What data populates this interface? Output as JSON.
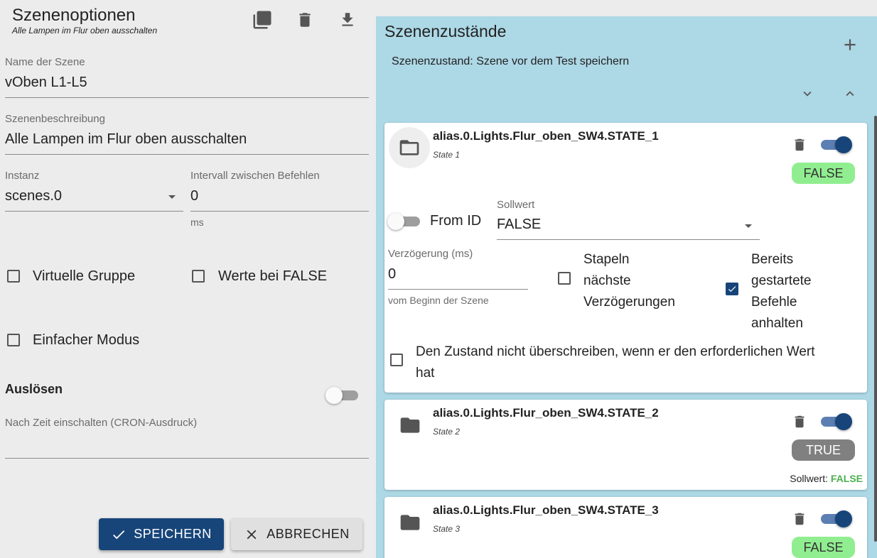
{
  "left": {
    "title": "Szenenoptionen",
    "subtitle": "Alle Lampen im Flur oben ausschalten",
    "name_label": "Name der Szene",
    "name_value": "vOben L1-L5",
    "desc_label": "Szenenbeschreibung",
    "desc_value": "Alle Lampen im Flur oben ausschalten",
    "instance_label": "Instanz",
    "instance_value": "scenes.0",
    "interval_label": "Intervall zwischen Befehlen",
    "interval_value": "0",
    "interval_unit": "ms",
    "virtual_group_label": "Virtuelle Gruppe",
    "values_false_label": "Werte bei FALSE",
    "simple_mode_label": "Einfacher Modus",
    "trigger_heading": "Auslösen",
    "cron_label": "Nach Zeit einschalten (CRON-Ausdruck)",
    "save_label": "SPEICHERN",
    "cancel_label": "ABBRECHEN"
  },
  "right": {
    "title": "Szenenzustände",
    "state_info": "Szenenzustand: Szene vor dem Test speichern",
    "cards": [
      {
        "id": "alias.0.Lights.Flur_oben_SW4.STATE_1",
        "sub": "State 1",
        "badge": "FALSE",
        "from_id_label": "From ID",
        "setpoint_label": "Sollwert",
        "setpoint_value": "FALSE",
        "delay_label": "Verzögerung (ms)",
        "delay_value": "0",
        "delay_helper": "vom Beginn der Szene",
        "stack_label_1": "Stapeln",
        "stack_label_2": "nächste",
        "stack_label_3": "Verzögerungen",
        "stop_label_1": "Bereits",
        "stop_label_2": "gestartete",
        "stop_label_3": "Befehle",
        "stop_label_4": "anhalten",
        "no_overwrite_label_1": "Den Zustand nicht überschreiben, wenn er den erforderlichen Wert",
        "no_overwrite_label_2": "hat"
      },
      {
        "id": "alias.0.Lights.Flur_oben_SW4.STATE_2",
        "sub": "State 2",
        "badge": "TRUE",
        "setpoint_prefix": "Sollwert:",
        "setpoint_value": "FALSE"
      },
      {
        "id": "alias.0.Lights.Flur_oben_SW4.STATE_3",
        "sub": "State 3",
        "badge": "FALSE"
      }
    ]
  },
  "colors": {
    "primary": "#17457a",
    "panel": "#add8e6",
    "badge_false": "#90ee90",
    "badge_true": "#808080",
    "setpoint_green": "#4caf50"
  },
  "icons": [
    "copy-icon",
    "delete-icon",
    "download-icon",
    "add-icon",
    "chevron-down-icon",
    "chevron-up-icon",
    "folder-open-icon",
    "folder-icon",
    "check-icon",
    "close-icon",
    "dropdown-arrow-icon"
  ]
}
